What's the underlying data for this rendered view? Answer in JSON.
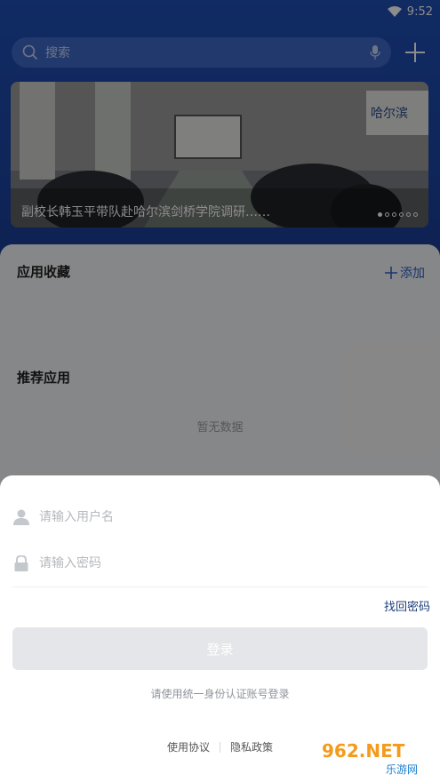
{
  "status": {
    "time": "9:52",
    "icons": [
      "wifi-icon"
    ]
  },
  "search": {
    "placeholder": "搜索"
  },
  "banner": {
    "caption": "副校长韩玉平带队赴哈尔滨剑桥学院调研……",
    "page_count": 6,
    "active_index": 0,
    "sign_text": "哈尔滨"
  },
  "favorites": {
    "title": "应用收藏",
    "add_label": "添加"
  },
  "recommended": {
    "title": "推荐应用",
    "empty_text": "暂无数据"
  },
  "login": {
    "username_placeholder": "请输入用户名",
    "password_placeholder": "请输入密码",
    "forgot_label": "找回密码",
    "login_label": "登录",
    "hint": "请使用统一身份认证账号登录",
    "terms_label": "使用协议",
    "privacy_label": "隐私政策"
  },
  "watermark": {
    "text": "962.NET",
    "subtext": "乐游网"
  },
  "colors": {
    "primary": "#1f4fb5",
    "link": "#2b5fc7",
    "button_disabled": "#e4e6e9"
  }
}
